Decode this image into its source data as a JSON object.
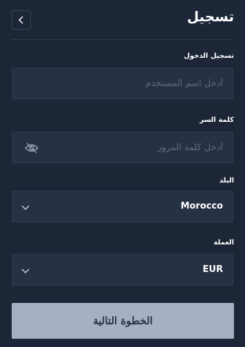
{
  "header": {
    "title": "تسجيل",
    "back_icon": "chevron-left-icon"
  },
  "form": {
    "username": {
      "label": "تسجيل الدخول",
      "placeholder": "أدخل اسم المستخدم",
      "value": ""
    },
    "password": {
      "label": "كلمة السر",
      "placeholder": "أدخل كلمة المرور",
      "value": "",
      "visibility_icon": "eye-off-icon"
    },
    "country": {
      "label": "البلد",
      "value": "Morocco",
      "icon": "chevron-down-icon"
    },
    "currency": {
      "label": "العملة",
      "value": "EUR",
      "icon": "chevron-down-icon"
    }
  },
  "next_button": {
    "label": "الخطوة التالية"
  },
  "colors": {
    "background": "#1c2636",
    "field": "#263244",
    "button": "#a6b0c2"
  }
}
